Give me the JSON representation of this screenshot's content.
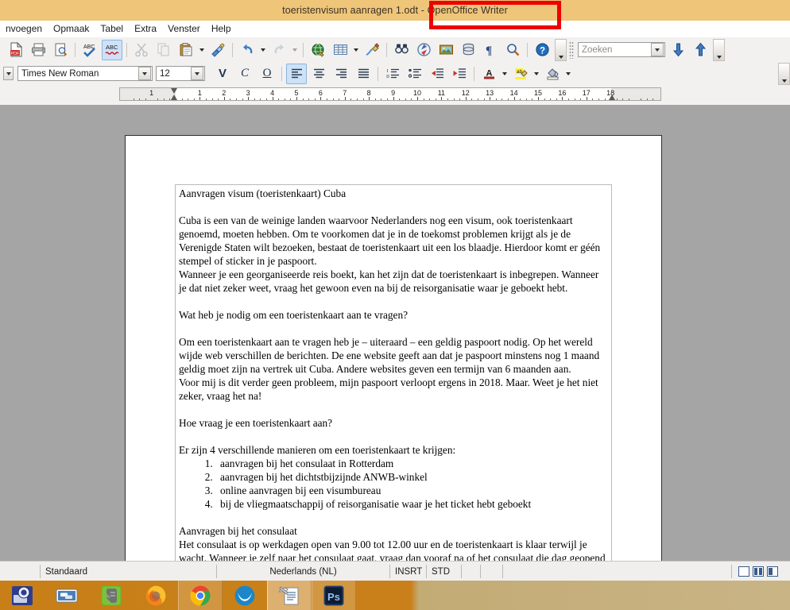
{
  "window": {
    "title": "toeristenvisum aanragen 1.odt - OpenOffice Writer",
    "annotation_color": "#ee0000",
    "titlebar_color": "#efc579"
  },
  "menubar": {
    "items": [
      {
        "label": "nvoegen",
        "accel": "n"
      },
      {
        "label": "Opmaak",
        "accel": "O"
      },
      {
        "label": "Tabel",
        "accel": "a"
      },
      {
        "label": "Extra",
        "accel": "x"
      },
      {
        "label": "Venster",
        "accel": "V"
      },
      {
        "label": "Help",
        "accel": "H"
      }
    ]
  },
  "toolbar_standard": {
    "buttons": [
      {
        "name": "export-pdf-icon",
        "tooltip": "Exporteren als PDF"
      },
      {
        "name": "print-icon",
        "tooltip": "Afdrukken"
      },
      {
        "name": "print-preview-icon",
        "tooltip": "Afdrukvoorbeeld"
      },
      {
        "name": "spelling-icon",
        "tooltip": "Spelling en grammatica"
      },
      {
        "name": "autospellcheck-icon",
        "tooltip": "Automatische spellingcontrole",
        "active": true
      },
      {
        "name": "cut-icon",
        "tooltip": "Knippen",
        "disabled": true
      },
      {
        "name": "copy-icon",
        "tooltip": "Kopiëren",
        "disabled": true
      },
      {
        "name": "paste-icon",
        "tooltip": "Plakken"
      },
      {
        "name": "clone-formatting-icon",
        "tooltip": "Opmaak klonen"
      },
      {
        "name": "undo-icon",
        "tooltip": "Ongedaan maken"
      },
      {
        "name": "redo-icon",
        "tooltip": "Opnieuw",
        "disabled": true
      },
      {
        "name": "hyperlink-icon",
        "tooltip": "Hyperlink"
      },
      {
        "name": "table-icon",
        "tooltip": "Tabel"
      },
      {
        "name": "draw-functions-icon",
        "tooltip": "Tekenfuncties"
      },
      {
        "name": "find-replace-icon",
        "tooltip": "Zoeken en vervangen"
      },
      {
        "name": "navigator-icon",
        "tooltip": "Navigator"
      },
      {
        "name": "gallery-icon",
        "tooltip": "Gallery"
      },
      {
        "name": "data-sources-icon",
        "tooltip": "Gegevensbronnen"
      },
      {
        "name": "formatting-marks-icon",
        "tooltip": "Opmaakmarkeringen"
      },
      {
        "name": "zoom-icon",
        "tooltip": "Zoomen"
      },
      {
        "name": "help-icon",
        "tooltip": "Help"
      }
    ],
    "search": {
      "placeholder": "Zoeken",
      "value": "",
      "find-next": "Volgende zoeken",
      "find-previous": "Vorige zoeken"
    }
  },
  "toolbar_formatting": {
    "font_name": "Times New Roman",
    "font_size": "12",
    "bold_label": "V",
    "italic_label": "C",
    "underline_label": "O",
    "align_active": "left",
    "buttons": [
      {
        "name": "align-left-icon",
        "active": true
      },
      {
        "name": "align-center-icon",
        "active": false
      },
      {
        "name": "align-right-icon",
        "active": false
      },
      {
        "name": "align-justify-icon",
        "active": false
      },
      {
        "name": "ordered-list-icon"
      },
      {
        "name": "unordered-list-icon"
      },
      {
        "name": "decrease-indent-icon"
      },
      {
        "name": "increase-indent-icon"
      },
      {
        "name": "font-color-icon"
      },
      {
        "name": "highlighting-icon"
      },
      {
        "name": "background-color-icon"
      }
    ]
  },
  "ruler": {
    "unit": "cm",
    "labels_left": [
      "1"
    ],
    "labels": [
      "1",
      "2",
      "3",
      "4",
      "5",
      "6",
      "7",
      "8",
      "9",
      "10",
      "11",
      "12",
      "13",
      "14",
      "15",
      "16",
      "17",
      "18"
    ]
  },
  "document": {
    "heading": "Aanvragen visum (toeristenkaart) Cuba",
    "paragraphs": [
      "Cuba is een van de weinige landen waarvoor Nederlanders nog een visum, ook toeristenkaart genoemd, moeten hebben. Om te voorkomen  dat je in de toekomst problemen krijgt als je de Verenigde Staten wilt bezoeken, bestaat de toeristenkaart uit een los blaadje. Hierdoor komt er géén stempel of sticker in je paspoort.",
      "Wanneer je een georganiseerde reis boekt, kan het zijn dat de toeristenkaart is inbegrepen. Wanneer je dat niet zeker weet, vraag het gewoon even na bij de reisorganisatie waar je geboekt hebt."
    ],
    "question1": "Wat heb je nodig om een toeristenkaart aan te vragen?",
    "paragraphs2": [
      "Om een toeristenkaart aan te vragen heb je – uiteraard – een geldig paspoort nodig. Op het wereld wijde web verschillen de berichten. De ene website geeft aan dat je paspoort minstens nog 1 maand geldig moet zijn na vertrek uit Cuba. Andere websites geven een termijn van 6 maanden aan.",
      "Voor mij is dit verder geen probleem, mijn paspoort verloopt ergens in 2018. Maar. Weet je het niet zeker, vraag het na!"
    ],
    "question2": "Hoe vraag je een toeristenkaart aan?",
    "list_intro": "Er zijn 4 verschillende manieren om een toeristenkaart te krijgen:",
    "list_items": [
      "aanvragen bij het consulaat in Rotterdam",
      "aanvragen bij het dichtstbijzijnde ANWB-winkel",
      "online aanvragen bij een visumbureau",
      "bij de vliegmaatschappij of reisorganisatie waar je het ticket hebt geboekt"
    ],
    "subheading": "Aanvragen bij het consulaat",
    "paragraph3": "Het consulaat is op werkdagen open van 9.00 tot 12.00 uur en de toeristenkaart is klaar terwijl je wacht. Wanneer je zelf naar het consulaat gaat, vraag dan vooraf na of het consulaat die dag geopend is. Op Nederlandse én Cubaanse feestdagen zijn ze namelijk gesloten. Voor het aanvragen"
  },
  "statusbar": {
    "page_style": "Standaard",
    "language": "Nederlands (NL)",
    "insert_mode": "INSRT",
    "selection_mode": "STD",
    "modified": "",
    "digital_signature": "",
    "view_single": "single-page-view-icon",
    "view_multi": "multi-page-view-icon",
    "view_book": "book-view-icon"
  },
  "taskbar": {
    "items": [
      {
        "name": "taskbar-screen-capture",
        "label": "Schermopname",
        "state": "pinned"
      },
      {
        "name": "taskbar-messenger",
        "label": "Berichten",
        "state": "pinned"
      },
      {
        "name": "taskbar-evernote",
        "label": "Evernote",
        "state": "pinned"
      },
      {
        "name": "taskbar-firefox",
        "label": "Mozilla Firefox",
        "state": "pinned"
      },
      {
        "name": "taskbar-chrome",
        "label": "Google Chrome",
        "state": "open"
      },
      {
        "name": "taskbar-openoffice",
        "label": "OpenOffice",
        "state": "pinned"
      },
      {
        "name": "taskbar-writer",
        "label": "OpenOffice Writer",
        "state": "active"
      },
      {
        "name": "taskbar-photoshop",
        "label": "Adobe Photoshop",
        "state": "open"
      }
    ]
  }
}
